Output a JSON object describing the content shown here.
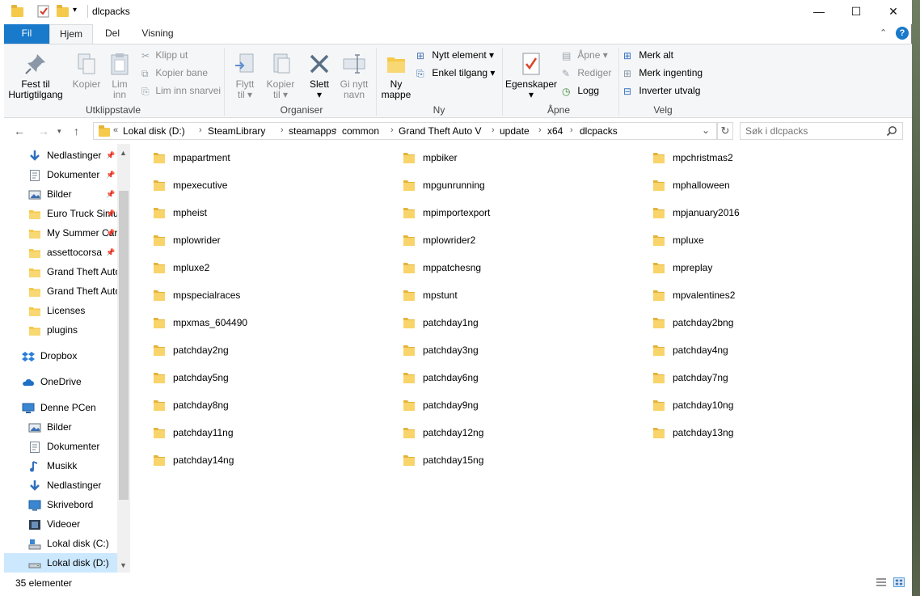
{
  "window": {
    "title": "dlcpacks",
    "controls": {
      "minimize": "—",
      "maximize": "☐",
      "close": "✕"
    }
  },
  "ribbon": {
    "tabs": [
      {
        "label": "Fil"
      },
      {
        "label": "Hjem"
      },
      {
        "label": "Del"
      },
      {
        "label": "Visning"
      }
    ],
    "groups": {
      "utklippstavle": {
        "label": "Utklippstavle",
        "fest_til_line1": "Fest til",
        "fest_til_line2": "Hurtigtilgang",
        "kopier": "Kopier",
        "lim_inn_line1": "Lim",
        "lim_inn_line2": "inn",
        "klipp_ut": "Klipp ut",
        "kopier_bane": "Kopier bane",
        "lim_inn_snarvei": "Lim inn snarvei"
      },
      "organiser": {
        "label": "Organiser",
        "flytt_line1": "Flytt",
        "flytt_line2": "til",
        "kopier_line1": "Kopier",
        "kopier_line2": "til",
        "slett": "Slett",
        "gi_nytt_line1": "Gi nytt",
        "gi_nytt_line2": "navn"
      },
      "ny": {
        "label": "Ny",
        "ny_mappe_line1": "Ny",
        "ny_mappe_line2": "mappe",
        "nytt_element": "Nytt element",
        "enkel_tilgang": "Enkel tilgang"
      },
      "apne": {
        "label": "Åpne",
        "egenskaper": "Egenskaper",
        "apne": "Åpne",
        "rediger": "Rediger",
        "logg": "Logg"
      },
      "velg": {
        "label": "Velg",
        "merk_alt": "Merk alt",
        "merk_ingenting": "Merk ingenting",
        "inverter_utvalg": "Inverter utvalg"
      }
    }
  },
  "address": {
    "prefix": "«",
    "crumbs": [
      "Lokal disk (D:)",
      "SteamLibrary",
      "steamapps",
      "common",
      "Grand Theft Auto V",
      "update",
      "x64",
      "dlcpacks"
    ],
    "search_placeholder": "Søk i dlcpacks"
  },
  "nav": {
    "quick_access": [
      {
        "label": "Nedlastinger",
        "icon": "download-icon",
        "pinned": true
      },
      {
        "label": "Dokumenter",
        "icon": "documents-icon",
        "pinned": true
      },
      {
        "label": "Bilder",
        "icon": "pictures-icon",
        "pinned": true
      },
      {
        "label": "Euro Truck Simulator",
        "icon": "folder-icon",
        "pinned": true
      },
      {
        "label": "My Summer Car",
        "icon": "folder-icon",
        "pinned": true
      },
      {
        "label": "assettocorsa",
        "icon": "folder-icon",
        "pinned": true
      },
      {
        "label": "Grand Theft Auto",
        "icon": "folder-icon",
        "pinned": false
      },
      {
        "label": "Grand Theft Auto",
        "icon": "folder-icon",
        "pinned": false
      },
      {
        "label": "Licenses",
        "icon": "folder-icon",
        "pinned": false
      },
      {
        "label": "plugins",
        "icon": "folder-icon",
        "pinned": false
      }
    ],
    "dropbox": "Dropbox",
    "onedrive": "OneDrive",
    "this_pc": "Denne PCen",
    "pc_items": [
      {
        "label": "Bilder",
        "icon": "pictures-icon"
      },
      {
        "label": "Dokumenter",
        "icon": "documents-icon"
      },
      {
        "label": "Musikk",
        "icon": "music-icon"
      },
      {
        "label": "Nedlastinger",
        "icon": "download-icon"
      },
      {
        "label": "Skrivebord",
        "icon": "desktop-icon"
      },
      {
        "label": "Videoer",
        "icon": "videos-icon"
      },
      {
        "label": "Lokal disk (C:)",
        "icon": "drive-c-icon"
      },
      {
        "label": "Lokal disk (D:)",
        "icon": "drive-icon",
        "selected": true
      }
    ]
  },
  "folders": [
    "mpapartment",
    "mpbiker",
    "mpchristmas2",
    "mpexecutive",
    "mpgunrunning",
    "mphalloween",
    "mpheist",
    "mpimportexport",
    "mpjanuary2016",
    "mplowrider",
    "mplowrider2",
    "mpluxe",
    "mpluxe2",
    "mppatchesng",
    "mpreplay",
    "mpspecialraces",
    "mpstunt",
    "mpvalentines2",
    "mpxmas_604490",
    "patchday1ng",
    "patchday2bng",
    "patchday2ng",
    "patchday3ng",
    "patchday4ng",
    "patchday5ng",
    "patchday6ng",
    "patchday7ng",
    "patchday8ng",
    "patchday9ng",
    "patchday10ng",
    "patchday11ng",
    "patchday12ng",
    "patchday13ng",
    "patchday14ng",
    "patchday15ng"
  ],
  "status": {
    "count": "35 elementer"
  },
  "colors": {
    "file_tab": "#1979ca",
    "selected": "#cce8ff",
    "folder": "#f5c94a"
  }
}
